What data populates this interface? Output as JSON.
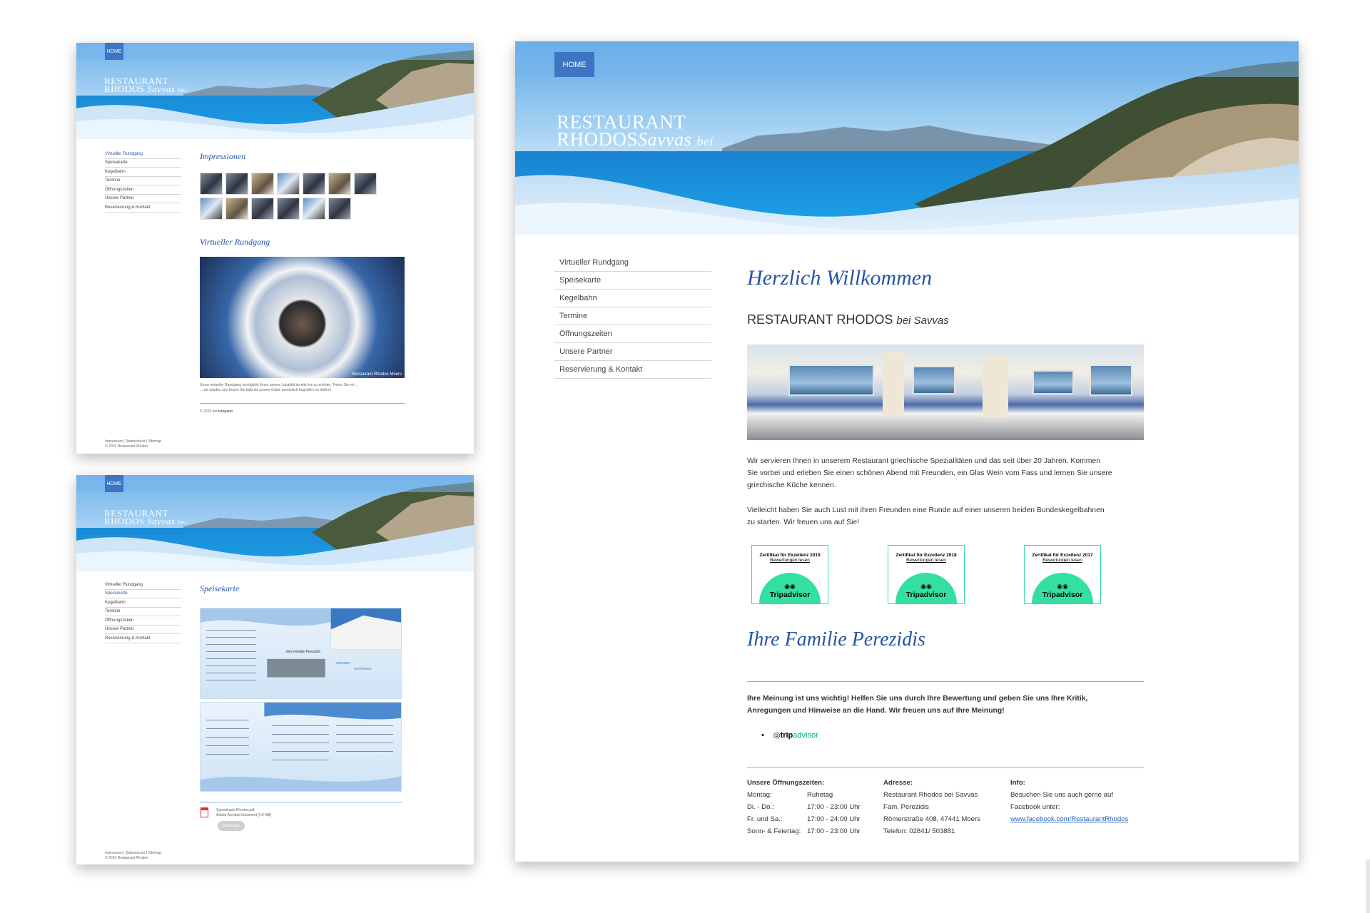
{
  "brand": {
    "line1": "RESTAURANT",
    "line2": "RHODOS",
    "bei": "bei",
    "savvas": "Savvas"
  },
  "nav": {
    "home": "HOME"
  },
  "menu": {
    "items": [
      "Virtueller Rundgang",
      "Speisekarte",
      "Kegelbahn",
      "Termine",
      "Öffnungszeiten",
      "Unsere Partner",
      "Reservierung & Kontakt"
    ]
  },
  "page_a": {
    "heading_impressionen": "Impressionen",
    "heading_rundgang": "Virtueller Rundgang",
    "tour_label": "Restaurant Rhodos Moers",
    "text_1": "Unser virtueller Rundgang ermöglicht Ihnen unsere Lokalität bereits live zu erleben. Treten Sie ein ...",
    "text_2": "... wir würden uns freuen Sie bald als unsere Gäste persönlich begrüßen zu dürfen!",
    "credit": "© 2019 bei",
    "credit_brand": "telepano",
    "footer_links": "Impressum | Datenschutz | Sitemap",
    "footer_copy": "© 2019 Restaurant Rhodos"
  },
  "page_b": {
    "heading": "Speisekarte",
    "doc_spezialitaeten": "SPEISEN",
    "doc_getraenke": "GETRÄNKE",
    "doc_family": "Ihre Familie Perezidis",
    "file_name": "Speisekarte Rhodos.pdf",
    "file_type": "Adobe Acrobat Dokument [4.3 MB]",
    "download": "Download",
    "footer_links": "Impressum | Datenschutz | Sitemap",
    "footer_copy": "© 2019 Restaurant Rhodos"
  },
  "main": {
    "welcome": "Herzlich Willkommen",
    "title_main": "RESTAURANT RHODOS",
    "title_bei": "bei Savvas",
    "para_1_a": "Wir servieren Ihnen in unserem Restaurant griechische Spezialitäten und das seit über 20 Jahren. Kommen",
    "para_1_b": "Sie vorbei und erleben Sie einen schönen Abend mit Freunden, ein Glas Wein vom Fass und lernen Sie unsere",
    "para_1_c": "griechische Küche kennen.",
    "para_2_a": "Vielleicht haben Sie auch Lust mit ihren Freunden eine Runde auf einer unseren beiden Bundeskegelbahnen",
    "para_2_b": "zu starten. Wir freuen uns auf Sie!",
    "badges": [
      {
        "title": "Zertifikat für Exzellenz 2019",
        "link": "Bewertungen lesen",
        "brand": "Tripadvisor"
      },
      {
        "title": "Zertifikat für Exzellenz 2018",
        "link": "Bewertungen lesen",
        "brand": "Tripadvisor"
      },
      {
        "title": "Zertifikat für Exzellenz 2017",
        "link": "Bewertungen lesen",
        "brand": "Tripadvisor"
      }
    ],
    "family": "Ihre Familie Perezidis",
    "feedback_a": "Ihre Meinung ist uns wichtig! Helfen Sie uns durch Ihre Bewertung und geben Sie uns Ihre Kritik,",
    "feedback_b": "Anregungen und Hinweise an die Hand. Wir freuen uns auf Ihre Meinung!",
    "ta_trip": "trip",
    "ta_advisor": "advisor",
    "hours": {
      "heading": "Unsere Öffnungszeiten:",
      "rows": [
        {
          "day": "Montag:",
          "time": "Ruhetag"
        },
        {
          "day": "Di. - Do.:",
          "time": "17:00 - 23:00 Uhr"
        },
        {
          "day": "Fr. und Sa.:",
          "time": "17:00 - 24:00 Uhr"
        },
        {
          "day": "Sonn- & Feiertag:",
          "time": "17:00 - 23:00 Uhr"
        }
      ]
    },
    "address": {
      "heading": "Adresse:",
      "lines": [
        "Restaurant Rhodos bei Savvas",
        "Fam. Perezidis",
        "Römerstraße 408, 47441 Moers",
        "Telefon: 02841/ 503881"
      ]
    },
    "info": {
      "heading": "Info:",
      "line1": "Besuchen Sie uns auch gerne auf",
      "line2": "Facebook unter:",
      "link": "www.facebook.com/RestaurantRhodos"
    }
  }
}
